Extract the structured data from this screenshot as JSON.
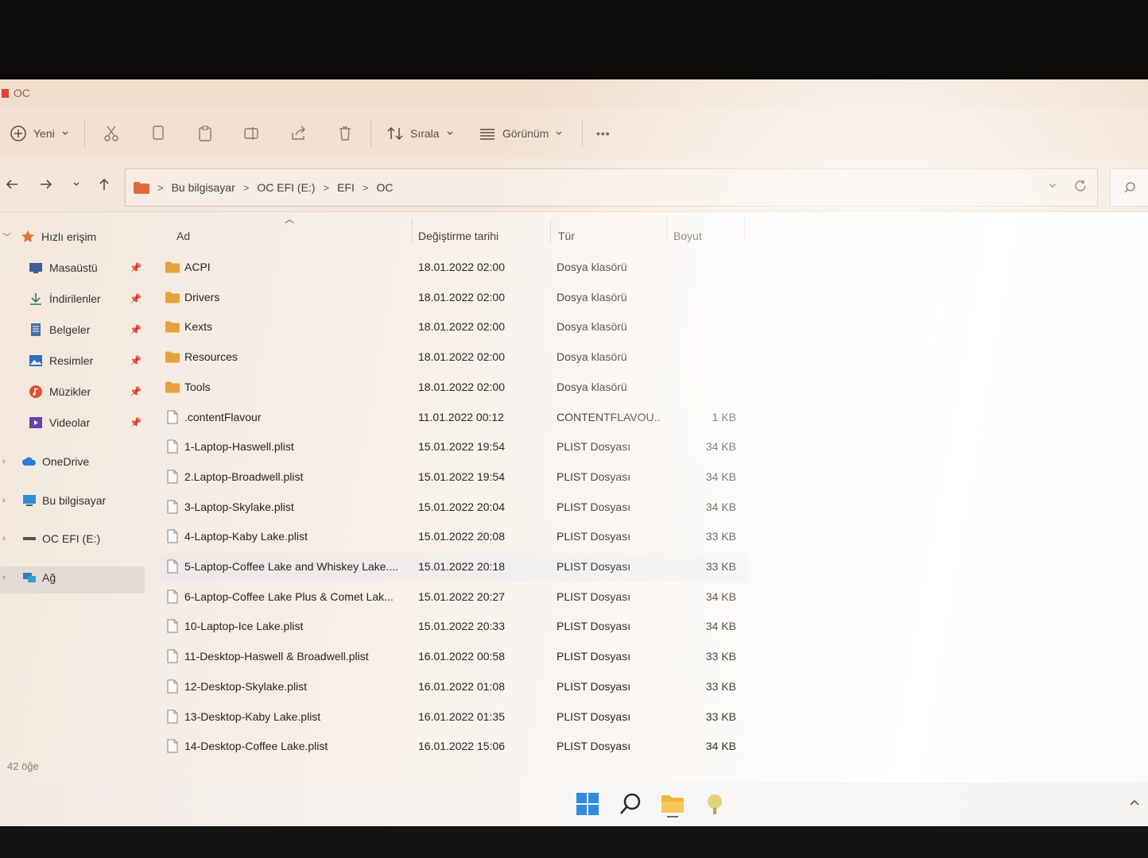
{
  "window": {
    "title": "OC"
  },
  "toolbar": {
    "new_label": "Yeni",
    "sort_label": "Sırala",
    "view_label": "Görünüm",
    "more_label": "•••"
  },
  "address": {
    "breadcrumbs": [
      "Bu bilgisayar",
      "OC EFI (E:)",
      "EFI",
      "OC"
    ]
  },
  "sidebar": {
    "items": [
      {
        "label": "Hızlı erişim",
        "icon": "star-icon"
      },
      {
        "label": "Masaüstü",
        "icon": "desktop-icon"
      },
      {
        "label": "İndirilenler",
        "icon": "download-icon"
      },
      {
        "label": "Belgeler",
        "icon": "documents-icon"
      },
      {
        "label": "Resimler",
        "icon": "pictures-icon"
      },
      {
        "label": "Müzikler",
        "icon": "music-icon"
      },
      {
        "label": "Videolar",
        "icon": "videos-icon"
      },
      {
        "label": "OneDrive",
        "icon": "cloud-icon"
      },
      {
        "label": "Bu bilgisayar",
        "icon": "computer-icon"
      },
      {
        "label": "OC EFI (E:)",
        "icon": "drive-icon"
      },
      {
        "label": "Ağ",
        "icon": "network-icon"
      }
    ]
  },
  "columns": {
    "name": "Ad",
    "modified": "Değiştirme tarihi",
    "type": "Tür",
    "size": "Boyut"
  },
  "files": [
    {
      "name": "ACPI",
      "modified": "18.01.2022 02:00",
      "type": "Dosya klasörü",
      "size": "",
      "kind": "folder"
    },
    {
      "name": "Drivers",
      "modified": "18.01.2022 02:00",
      "type": "Dosya klasörü",
      "size": "",
      "kind": "folder"
    },
    {
      "name": "Kexts",
      "modified": "18.01.2022 02:00",
      "type": "Dosya klasörü",
      "size": "",
      "kind": "folder"
    },
    {
      "name": "Resources",
      "modified": "18.01.2022 02:00",
      "type": "Dosya klasörü",
      "size": "",
      "kind": "folder"
    },
    {
      "name": "Tools",
      "modified": "18.01.2022 02:00",
      "type": "Dosya klasörü",
      "size": "",
      "kind": "folder"
    },
    {
      "name": ".contentFlavour",
      "modified": "11.01.2022 00:12",
      "type": "CONTENTFLAVOU...",
      "size": "1 KB",
      "kind": "file"
    },
    {
      "name": "1-Laptop-Haswell.plist",
      "modified": "15.01.2022 19:54",
      "type": "PLIST Dosyası",
      "size": "34 KB",
      "kind": "file"
    },
    {
      "name": "2.Laptop-Broadwell.plist",
      "modified": "15.01.2022 19:54",
      "type": "PLIST Dosyası",
      "size": "34 KB",
      "kind": "file"
    },
    {
      "name": "3-Laptop-Skylake.plist",
      "modified": "15.01.2022 20:04",
      "type": "PLIST Dosyası",
      "size": "34 KB",
      "kind": "file"
    },
    {
      "name": "4-Laptop-Kaby Lake.plist",
      "modified": "15.01.2022 20:08",
      "type": "PLIST Dosyası",
      "size": "33 KB",
      "kind": "file"
    },
    {
      "name": "5-Laptop-Coffee Lake and Whiskey Lake....",
      "modified": "15.01.2022 20:18",
      "type": "PLIST Dosyası",
      "size": "33 KB",
      "kind": "file"
    },
    {
      "name": "6-Laptop-Coffee Lake Plus & Comet Lak...",
      "modified": "15.01.2022 20:27",
      "type": "PLIST Dosyası",
      "size": "34 KB",
      "kind": "file"
    },
    {
      "name": "10-Laptop-Ice Lake.plist",
      "modified": "15.01.2022 20:33",
      "type": "PLIST Dosyası",
      "size": "34 KB",
      "kind": "file"
    },
    {
      "name": "11-Desktop-Haswell & Broadwell.plist",
      "modified": "16.01.2022 00:58",
      "type": "PLIST Dosyası",
      "size": "33 KB",
      "kind": "file"
    },
    {
      "name": "12-Desktop-Skylake.plist",
      "modified": "16.01.2022 01:08",
      "type": "PLIST Dosyası",
      "size": "33 KB",
      "kind": "file"
    },
    {
      "name": "13-Desktop-Kaby Lake.plist",
      "modified": "16.01.2022 01:35",
      "type": "PLIST Dosyası",
      "size": "33 KB",
      "kind": "file"
    },
    {
      "name": "14-Desktop-Coffee Lake.plist",
      "modified": "16.01.2022 15:06",
      "type": "PLIST Dosyası",
      "size": "34 KB",
      "kind": "file"
    }
  ],
  "status": {
    "count": "42 öğe"
  },
  "taskbar": {
    "icons": [
      "windows-start-icon",
      "search-icon",
      "file-explorer-icon",
      "app-icon"
    ]
  },
  "colors": {
    "folder": "#e8a13a",
    "accent": "#0067c0"
  }
}
